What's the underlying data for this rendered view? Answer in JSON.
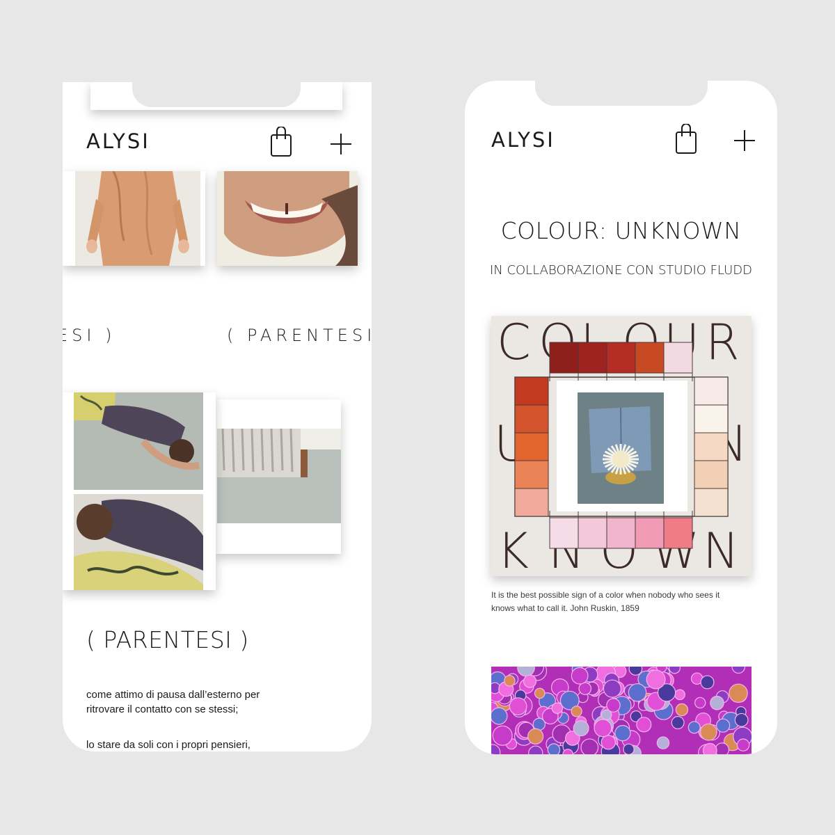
{
  "left_screen": {
    "brand": "ALYSI",
    "marquee": [
      "ESI )",
      "( PARENTESI"
    ],
    "heading": "( PARENTESI )",
    "paragraph_1": "come attimo di pausa dall’esterno per ritrovare il contatto con se stessi;",
    "paragraph_2": "lo stare da soli con i propri pensieri,",
    "icons": [
      "shopping-bag-icon",
      "plus-icon"
    ]
  },
  "right_screen": {
    "brand": "ALYSI",
    "title": "COLOUR: UNKNOWN",
    "subtitle": "IN COLLABORAZIONE CON STUDIO FLUDD",
    "artwork_words": [
      "COLOUR",
      "UNKNOWN"
    ],
    "caption": "It is the best possible sign of a color when nobody who sees it knows what to call it. John Ruskin, 1859",
    "icons": [
      "shopping-bag-icon",
      "plus-icon"
    ]
  },
  "colors": {
    "background": "#e7e7e7",
    "screen": "#ffffff",
    "text": "#1a1a1a",
    "artwork_bg": "#ebe8e4",
    "swatch_reds": [
      "#8e1f1a",
      "#9c2320",
      "#b42c23",
      "#c74a25",
      "#f3d9e1"
    ],
    "swatch_oranges": [
      "#c23b20",
      "#d2532c",
      "#e2642f",
      "#ea8458",
      "#f0a99a"
    ],
    "swatch_pinks": [
      "#f5dce6",
      "#f3c8da",
      "#f0b5cd",
      "#f19bb6",
      "#ef7c86"
    ],
    "swatch_creams": [
      "#f7ebe8",
      "#faf3ec",
      "#f6d9c4",
      "#f2d0b5",
      "#f4e0d0"
    ]
  }
}
